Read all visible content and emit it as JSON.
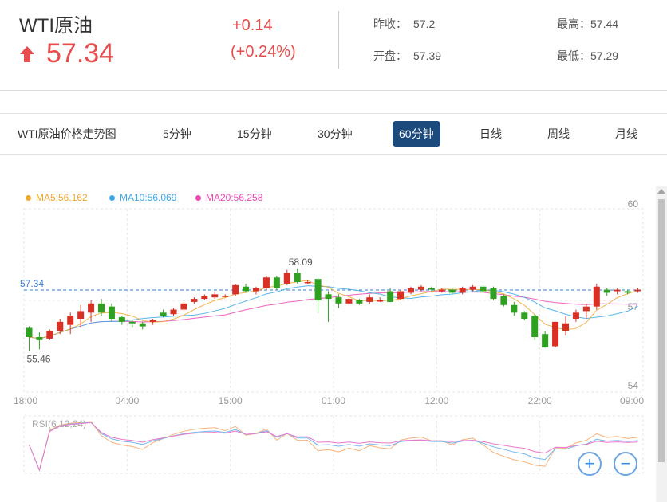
{
  "header": {
    "name": "WTI原油",
    "price": "57.34",
    "change": "+0.14",
    "change_pct": "(+0.24%)",
    "prev_close_label": "昨收：",
    "prev_close": "57.2",
    "open_label": "开盘：",
    "open": "57.39",
    "high_label": "最高：",
    "high": "57.44",
    "low_label": "最低：",
    "low": "57.29",
    "up_color": "#e84c4c"
  },
  "tabs": {
    "title": "WTI原油价格走势图",
    "items": [
      "5分钟",
      "15分钟",
      "30分钟",
      "60分钟",
      "日线",
      "周线",
      "月线"
    ],
    "active": "60分钟"
  },
  "legend": {
    "ma5": "MA5:56.162",
    "ma10": "MA10:56.069",
    "ma20": "MA20:56.258",
    "ma5_color": "#f0a830",
    "ma10_color": "#3fa8e6",
    "ma20_color": "#ec48b4"
  },
  "chart_data": {
    "type": "candlestick",
    "ylim": [
      54,
      60
    ],
    "y_ticks": [
      "60",
      "57",
      "54"
    ],
    "x_ticks": [
      "18:00",
      "04:00",
      "15:00",
      "01:00",
      "12:00",
      "22:00",
      "09:00"
    ],
    "current_price_label": "57.34",
    "current_price": 57.34,
    "max_label": "58.09",
    "min_label": "55.46",
    "rsi_label": "RSI(6,12,24)",
    "up_color": "#d93025",
    "down_color": "#2ea121",
    "candles": [
      [
        56.1,
        55.8,
        56.15,
        55.35
      ],
      [
        55.8,
        55.7,
        55.95,
        55.4
      ],
      [
        55.75,
        56.0,
        56.05,
        55.7
      ],
      [
        56.0,
        56.3,
        56.4,
        55.9
      ],
      [
        56.2,
        56.5,
        56.6,
        55.9
      ],
      [
        56.4,
        56.65,
        56.85,
        56.1
      ],
      [
        56.6,
        56.9,
        57.0,
        56.3
      ],
      [
        56.9,
        56.6,
        57.05,
        56.5
      ],
      [
        56.8,
        56.4,
        56.9,
        56.3
      ],
      [
        56.45,
        56.3,
        56.5,
        56.2
      ],
      [
        56.3,
        56.25,
        56.35,
        56.1
      ],
      [
        56.25,
        56.15,
        56.3,
        56.05
      ],
      [
        56.3,
        56.35,
        56.4,
        56.2
      ],
      [
        56.6,
        56.5,
        56.7,
        56.45
      ],
      [
        56.55,
        56.7,
        56.75,
        56.5
      ],
      [
        56.7,
        56.9,
        56.95,
        56.65
      ],
      [
        56.95,
        57.05,
        57.1,
        56.9
      ],
      [
        57.05,
        57.15,
        57.2,
        57.0
      ],
      [
        57.1,
        57.2,
        57.3,
        57.05
      ],
      [
        57.15,
        57.15,
        57.2,
        57.1
      ],
      [
        57.2,
        57.5,
        57.55,
        57.15
      ],
      [
        57.45,
        57.3,
        57.55,
        57.25
      ],
      [
        57.3,
        57.4,
        57.45,
        57.2
      ],
      [
        57.4,
        57.75,
        57.8,
        57.35
      ],
      [
        57.75,
        57.4,
        57.8,
        57.35
      ],
      [
        57.55,
        57.9,
        58.0,
        57.5
      ],
      [
        57.9,
        57.6,
        58.05,
        57.55
      ],
      [
        57.6,
        57.6,
        57.65,
        57.55
      ],
      [
        57.7,
        57.0,
        57.75,
        56.6
      ],
      [
        57.2,
        57.05,
        57.3,
        56.3
      ],
      [
        57.1,
        56.9,
        57.2,
        56.75
      ],
      [
        56.9,
        57.05,
        57.1,
        56.85
      ],
      [
        57.0,
        56.9,
        57.05,
        56.85
      ],
      [
        56.95,
        57.1,
        57.2,
        56.9
      ],
      [
        57.0,
        57.0,
        57.1,
        56.95
      ],
      [
        57.3,
        56.95,
        57.4,
        56.95
      ],
      [
        57.05,
        57.3,
        57.35,
        57.0
      ],
      [
        57.25,
        57.4,
        57.45,
        57.2
      ],
      [
        57.35,
        57.45,
        57.5,
        57.3
      ],
      [
        57.4,
        57.35,
        57.45,
        57.3
      ],
      [
        57.3,
        57.35,
        57.4,
        57.25
      ],
      [
        57.35,
        57.25,
        57.4,
        57.2
      ],
      [
        57.25,
        57.4,
        57.45,
        57.2
      ],
      [
        57.35,
        57.45,
        57.5,
        57.3
      ],
      [
        57.45,
        57.3,
        57.5,
        57.25
      ],
      [
        57.4,
        57.05,
        57.45,
        57.0
      ],
      [
        57.15,
        56.85,
        57.2,
        56.8
      ],
      [
        56.85,
        56.6,
        56.95,
        56.5
      ],
      [
        56.6,
        56.4,
        56.65,
        56.35
      ],
      [
        56.5,
        55.8,
        56.55,
        55.7
      ],
      [
        55.9,
        55.46,
        56.0,
        55.45
      ],
      [
        55.5,
        56.3,
        56.3,
        55.46
      ],
      [
        56.0,
        56.25,
        56.5,
        55.85
      ],
      [
        56.4,
        56.6,
        56.7,
        56.3
      ],
      [
        56.65,
        56.8,
        56.9,
        56.4
      ],
      [
        56.8,
        57.45,
        57.55,
        56.7
      ],
      [
        57.35,
        57.25,
        57.4,
        57.15
      ],
      [
        57.3,
        57.35,
        57.4,
        57.2
      ],
      [
        57.3,
        57.25,
        57.35,
        57.2
      ],
      [
        57.3,
        57.35,
        57.4,
        57.25
      ]
    ]
  }
}
